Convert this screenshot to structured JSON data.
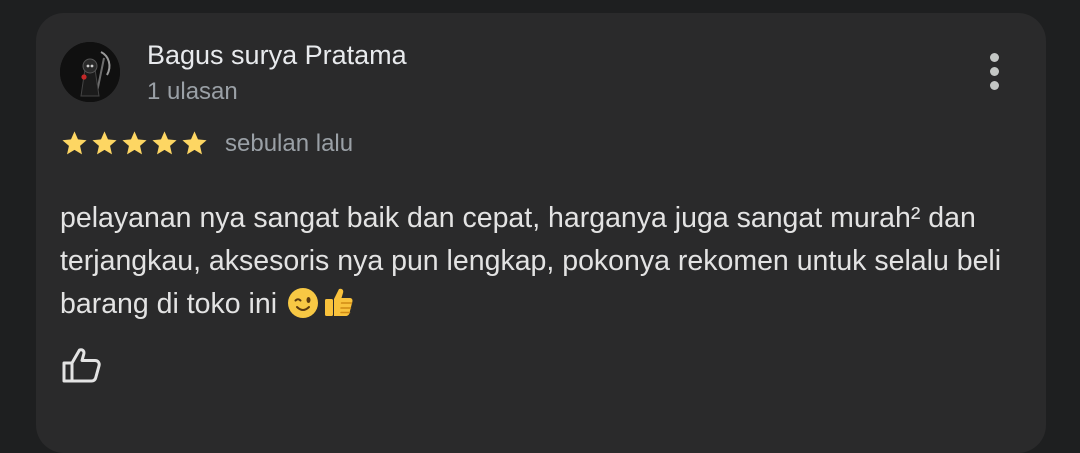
{
  "review": {
    "author_name": "Bagus surya Pratama",
    "author_reviews": "1 ulasan",
    "rating": 5,
    "rating_max": 5,
    "time_ago": "sebulan lalu",
    "text": "pelayanan nya sangat baik dan cepat, harganya juga sangat murah² dan terjangkau, aksesoris nya pun lengkap, pokonya rekomen untuk selalu beli barang di toko ini",
    "emojis": [
      "winking-face-emoji",
      "thumbs-up-emoji"
    ]
  },
  "colors": {
    "background": "#1e1f20",
    "card": "#2a2a2b",
    "star": "#fdd663",
    "name_text": "#e8eaed",
    "secondary_text": "#9aa0a6"
  }
}
